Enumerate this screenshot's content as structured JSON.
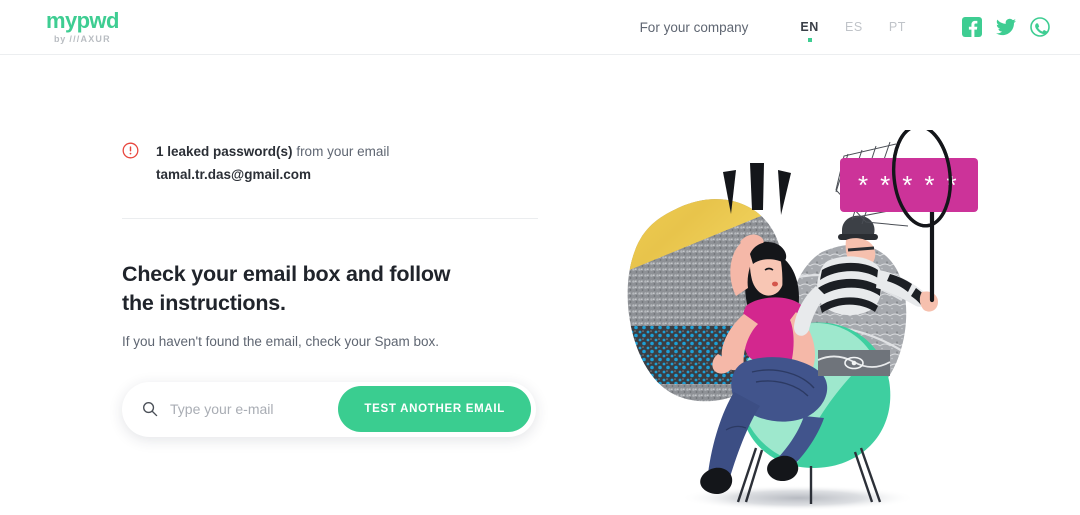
{
  "header": {
    "logo": {
      "name": "mypwd",
      "byline_prefix": "by ",
      "byline_brand": "///AXUR"
    },
    "for_company_label": "For your company",
    "languages": [
      {
        "code": "EN",
        "active": true
      },
      {
        "code": "ES",
        "active": false
      },
      {
        "code": "PT",
        "active": false
      }
    ],
    "socials": [
      {
        "icon": "facebook-icon"
      },
      {
        "icon": "twitter-icon"
      },
      {
        "icon": "whatsapp-icon"
      }
    ]
  },
  "alert": {
    "icon": "alert-circle-icon",
    "count_text": "1 leaked password(s)",
    "suffix_text": " from your email",
    "email": "tamal.tr.das@gmail.com"
  },
  "content": {
    "headline": "Check your email box and follow the instructions.",
    "subline": "If you haven't found the email, check your Spam box."
  },
  "search": {
    "icon": "search-icon",
    "placeholder": "Type your e-mail",
    "value": "",
    "button_label": "TEST ANOTHER EMAIL"
  },
  "illustration": {
    "name": "password-theft-illustration",
    "password_card_text": "* * * * *"
  },
  "colors": {
    "brand_green": "#3ECD92",
    "button_green": "#3ACD90",
    "alert_red": "#E8453C",
    "magenta": "#CC3399",
    "text_dark": "#20242b",
    "text_muted": "#5f6672"
  }
}
